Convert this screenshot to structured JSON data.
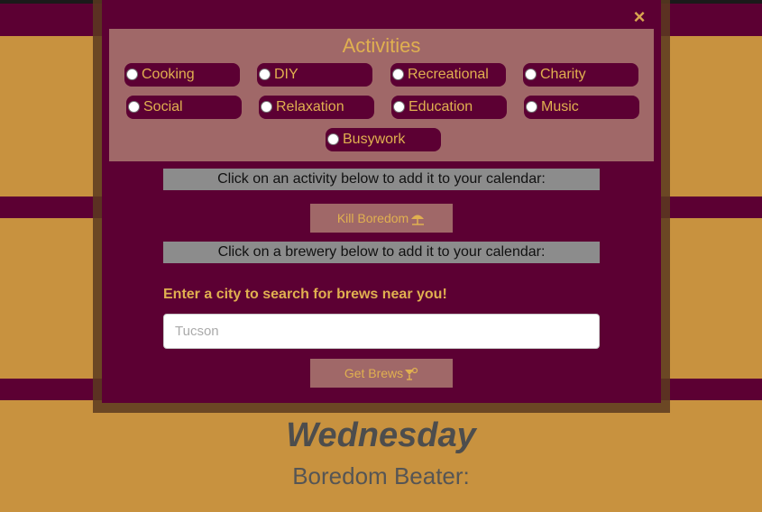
{
  "modal": {
    "close_icon": "×",
    "activities": {
      "title": "Activities",
      "options": [
        {
          "label": "Cooking"
        },
        {
          "label": "DIY"
        },
        {
          "label": "Recreational"
        },
        {
          "label": "Charity"
        },
        {
          "label": "Social"
        },
        {
          "label": "Relaxation"
        },
        {
          "label": "Education"
        },
        {
          "label": "Music"
        },
        {
          "label": "Busywork"
        }
      ]
    },
    "activity_instruction": "Click on an activity below to add it to your calendar:",
    "kill_boredom_label": "Kill Boredom",
    "kill_boredom_icon": "umbrella-beach-icon",
    "brewery_instruction": "Click on a brewery below to add it to your calendar:",
    "city_prompt": "Enter a city to search for brews near you!",
    "city_input": {
      "placeholder": "Tucson",
      "value": ""
    },
    "get_brews_label": "Get Brews",
    "get_brews_icon": "cocktail-icon"
  },
  "calendar": {
    "day_title": "Wednesday",
    "day_subtitle": "Boredom Beater:"
  },
  "colors": {
    "background": "#c8923f",
    "maroon": "#5c0033",
    "panel": "#a06868",
    "accent": "#e0b050",
    "bar_gray": "#8c8c8c"
  }
}
